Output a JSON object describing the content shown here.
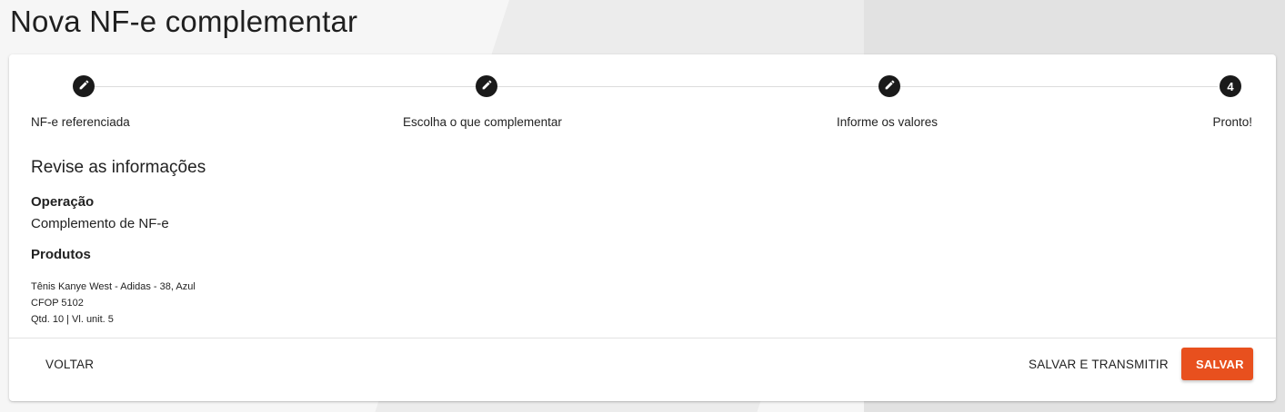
{
  "page": {
    "title": "Nova NF-e complementar"
  },
  "stepper": {
    "steps": [
      {
        "label": "NF-e referenciada",
        "icon": "pencil-icon",
        "number": ""
      },
      {
        "label": "Escolha o que complementar",
        "icon": "pencil-icon",
        "number": ""
      },
      {
        "label": "Informe os valores",
        "icon": "pencil-icon",
        "number": ""
      },
      {
        "label": "Pronto!",
        "icon": "",
        "number": "4"
      }
    ]
  },
  "review": {
    "title": "Revise as informações",
    "operacao_label": "Operação",
    "operacao_value": "Complemento de NF-e",
    "produtos_label": "Produtos",
    "product": {
      "name": "Tênis Kanye West - Adidas - 38, Azul",
      "cfop": "CFOP 5102",
      "qty": "Qtd. 10 | Vl. unit. 5"
    }
  },
  "actions": {
    "back_label": "VOLTAR",
    "save_transmit_label": "SALVAR E TRANSMITIR",
    "save_label": "SALVAR"
  },
  "colors": {
    "accent": "#e8501e",
    "step_circle": "#1a1a1a"
  }
}
